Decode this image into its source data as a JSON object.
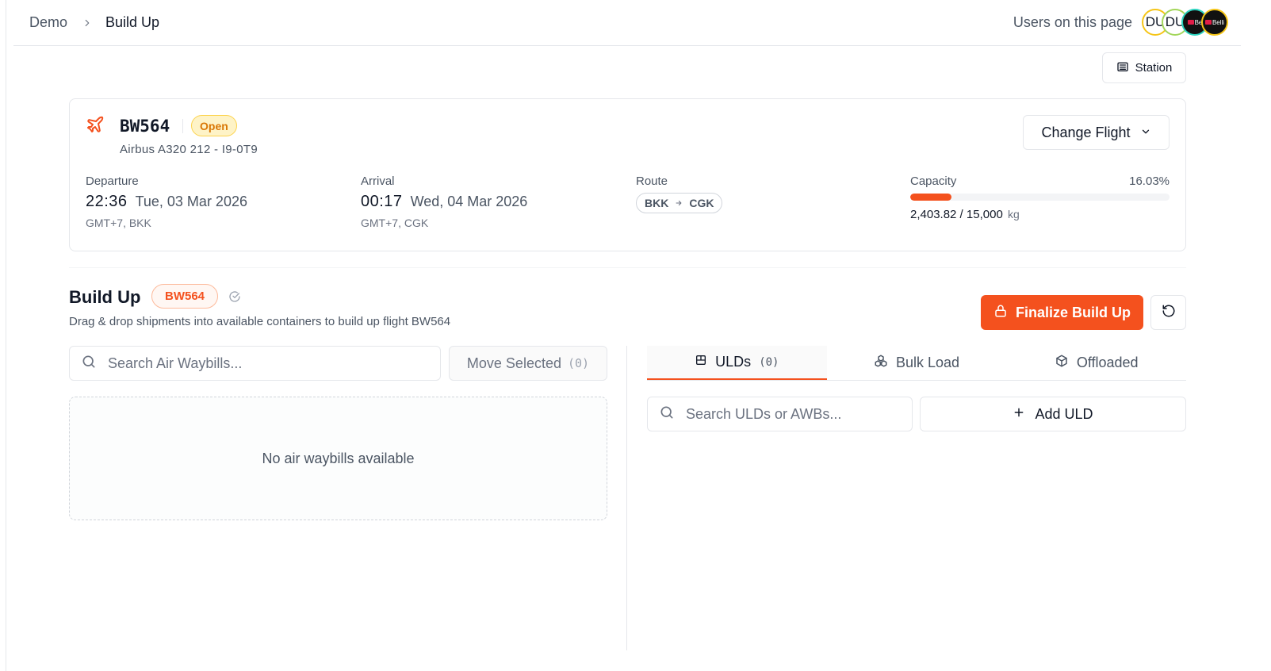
{
  "breadcrumb": {
    "root": "Demo",
    "current": "Build Up"
  },
  "presence": {
    "label": "Users on this page",
    "avatars": [
      "DU",
      "DU",
      "Be",
      "Belli"
    ]
  },
  "station_button": {
    "label": "Station",
    "icon": "building-icon"
  },
  "flight": {
    "number": "BW564",
    "status": "Open",
    "aircraft": "Airbus A320 212 - I9-0T9",
    "change_label": "Change Flight",
    "departure": {
      "label": "Departure",
      "time": "22:36",
      "date": "Tue, 03 Mar 2026",
      "tz": "GMT+7, BKK"
    },
    "arrival": {
      "label": "Arrival",
      "time": "00:17",
      "date": "Wed, 04 Mar 2026",
      "tz": "GMT+7, CGK"
    },
    "route": {
      "label": "Route",
      "from": "BKK",
      "to": "CGK"
    },
    "capacity": {
      "label": "Capacity",
      "percent_text": "16.03%",
      "fraction": 0.1603,
      "used": "2,403.82",
      "total": "15,000",
      "unit": "kg"
    }
  },
  "buildup": {
    "title": "Build Up",
    "flight_badge": "BW564",
    "description": "Drag & drop shipments into available containers to build up flight BW564",
    "finalize_label": "Finalize Build Up"
  },
  "awb_panel": {
    "search_placeholder": "Search Air Waybills...",
    "move_label": "Move Selected",
    "move_count": "(0)",
    "empty_text": "No air waybills available"
  },
  "uld_panel": {
    "tabs": [
      {
        "label": "ULDs",
        "count": "(0)",
        "icon": "container-icon"
      },
      {
        "label": "Bulk Load",
        "icon": "boxes-icon"
      },
      {
        "label": "Offloaded",
        "icon": "package-icon"
      }
    ],
    "search_placeholder": "Search ULDs or AWBs...",
    "add_label": "Add ULD"
  },
  "colors": {
    "accent": "#f4511e",
    "status_open_bg": "#fef3c7",
    "status_open_text": "#d97706"
  }
}
